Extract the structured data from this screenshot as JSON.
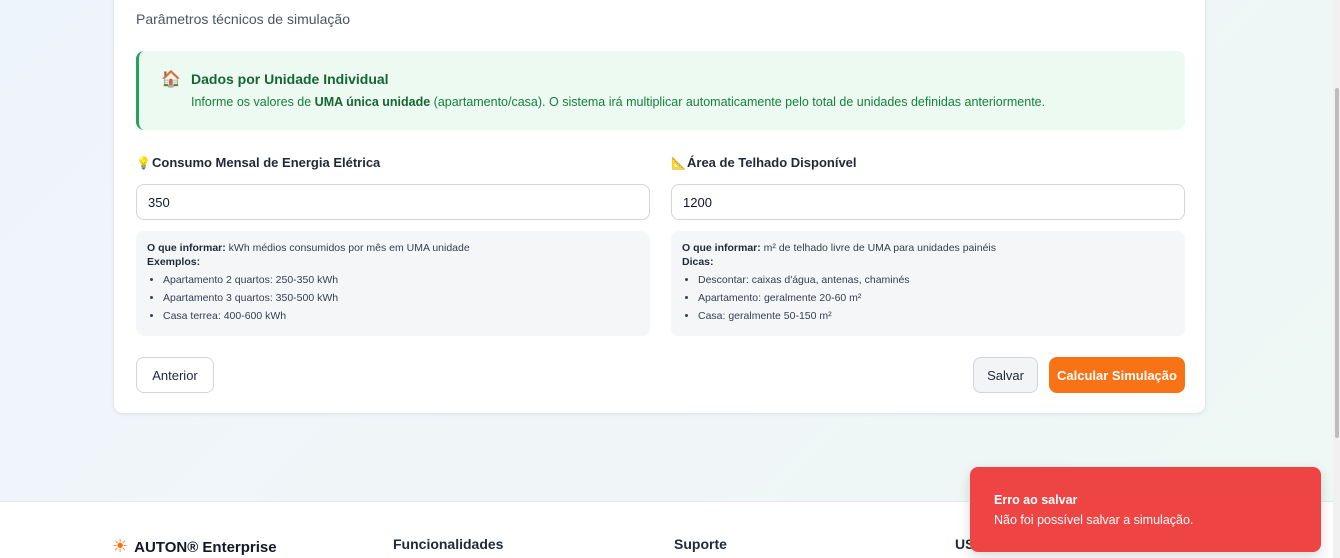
{
  "card": {
    "subtitle": "Parâmetros técnicos de simulação",
    "info": {
      "icon": "house-icon",
      "title": "Dados por Unidade Individual",
      "text_before": "Informe os valores de ",
      "text_bold": "UMA única unidade",
      "text_after": " (apartamento/casa). O sistema irá multiplicar automaticamente pelo total de unidades definidas anteriormente."
    },
    "consumo": {
      "icon": "lightbulb-icon",
      "label": "Consumo Mensal de Energia Elétrica",
      "value": "350",
      "help_title": "O que informar:",
      "help_text": " kWh médios consumidos por mês em UMA unidade",
      "list_title": "Exemplos:",
      "items": [
        "Apartamento 2 quartos: 250-350 kWh",
        "Apartamento 3 quartos: 350-500 kWh",
        "Casa terrea: 400-600 kWh"
      ]
    },
    "area": {
      "icon": "ruler-triangle-icon",
      "label": "Área de Telhado Disponível",
      "value": "1200",
      "help_title": "O que informar:",
      "help_text": " m² de telhado livre de UMA para unidades painéis",
      "list_title": "Dicas:",
      "items": [
        "Descontar: caixas d'água, antenas, chaminés",
        "Apartamento: geralmente 20-60 m²",
        "Casa: geralmente 50-150 m²"
      ]
    },
    "buttons": {
      "prev": "Anterior",
      "save": "Salvar",
      "calc": "Calcular Simulação"
    }
  },
  "footer": {
    "brand": "AUTON® Enterprise",
    "col1": "Funcionalidades",
    "col2": "Suporte",
    "col3": "US"
  },
  "toast": {
    "title": "Erro ao salvar",
    "message": "Não foi possível salvar a simulação."
  },
  "colors": {
    "accent": "#f97316",
    "success": "#22a55a",
    "error": "#ef4444"
  }
}
